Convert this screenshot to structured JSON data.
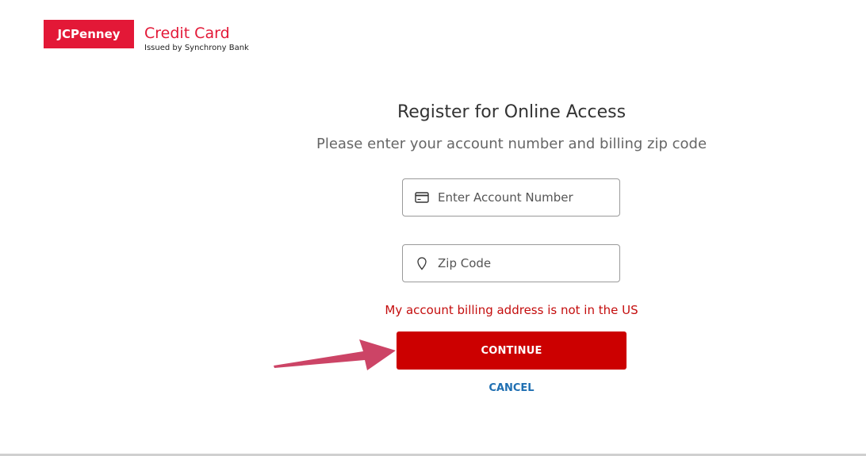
{
  "logo": {
    "brand": "JCPenney",
    "product": "Credit Card",
    "issuer": "Issued by Synchrony Bank"
  },
  "page": {
    "title": "Register for Online Access",
    "subtitle": "Please enter your account number and billing zip code"
  },
  "form": {
    "account_placeholder": "Enter Account Number",
    "account_value": "",
    "account_icon": "credit-card-icon",
    "zip_placeholder": "Zip Code",
    "zip_value": "",
    "zip_icon": "location-pin-icon",
    "billing_link": "My account billing address is not in the US",
    "continue_label": "CONTINUE",
    "cancel_label": "CANCEL"
  },
  "colors": {
    "brand_red": "#e31837",
    "button_red": "#cc0000",
    "link_red": "#c40d0d",
    "link_blue": "#1f6fb2",
    "annotation_arrow": "#cc4466"
  }
}
